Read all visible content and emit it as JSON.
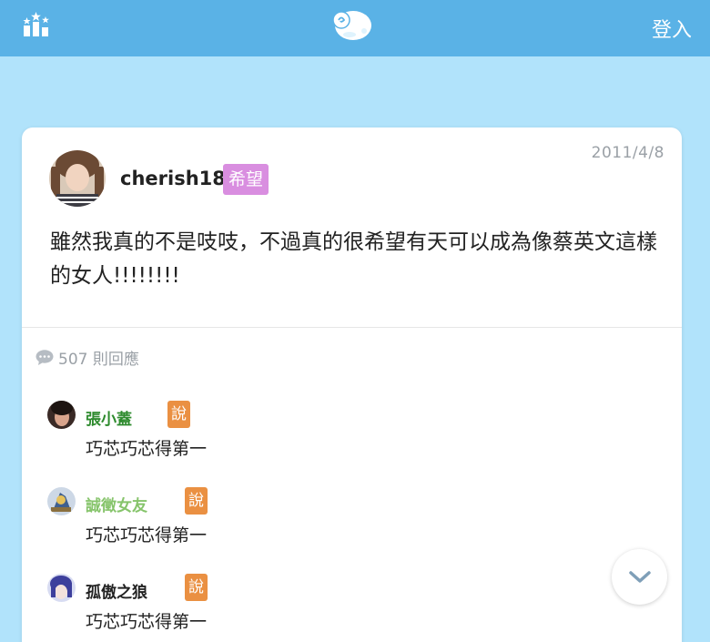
{
  "header": {
    "login_label": "登入",
    "rank_icon": "ranking-stars-icon",
    "logo_icon": "sheep-logo-icon",
    "bar_color": "#5ab2e6"
  },
  "post": {
    "author": "cherish18",
    "tag": "希望",
    "date": "2011/4/8",
    "text": "雖然我真的不是吱吱，不過真的很希望有天可以成為像蔡英文這樣的女人!!!!!!!!",
    "reply_count": "507 則回應",
    "tag_color": "#d98ee0"
  },
  "comments": [
    {
      "name": "張小蓋",
      "badge": "說",
      "text": "巧芯巧芯得第一",
      "name_color": "#2e8b2e"
    },
    {
      "name": "誠徵女友",
      "badge": "說",
      "text": "巧芯巧芯得第一",
      "name_color": "#86c46b"
    },
    {
      "name": "孤傲之狼",
      "badge": "說",
      "text": "巧芯巧芯得第一",
      "name_color": "#222222"
    }
  ]
}
